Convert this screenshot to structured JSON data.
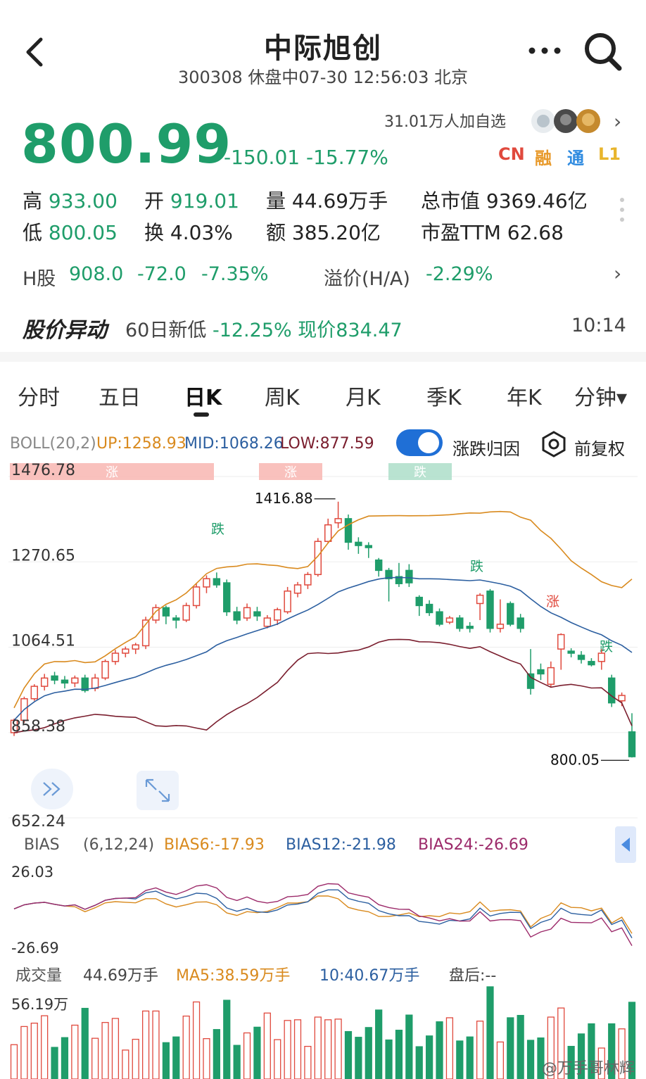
{
  "header": {
    "title": "中际旭创",
    "subtitle": "300308 休盘中07-30 12:56:03 北京"
  },
  "quote": {
    "price": "800.99",
    "change": "-150.01 -15.77%",
    "watch_count": "31.01万人加自选",
    "badges": [
      {
        "label": "CN",
        "color": "#e0493d"
      },
      {
        "label": "融",
        "color": "#e89a2c"
      },
      {
        "label": "通",
        "color": "#2f8be0"
      },
      {
        "label": "L1",
        "color": "#e8b52c"
      }
    ],
    "stats": {
      "high_label": "高",
      "high": "933.00",
      "open_label": "开",
      "open": "919.01",
      "volume_label": "量",
      "volume": "44.69万手",
      "mktcap_label": "总市值",
      "mktcap": "9369.46亿",
      "low_label": "低",
      "low": "800.05",
      "turnover_label": "换",
      "turnover": "4.03%",
      "amount_label": "额",
      "amount": "385.20亿",
      "pe_label": "市盈TTM",
      "pe": "62.68"
    },
    "hshare": {
      "label": "H股",
      "price": "908.0",
      "change": "-72.0",
      "pct": "-7.35%",
      "premium_label": "溢价(H/A)",
      "premium": "-2.29%"
    },
    "alert": {
      "title": "股价异动",
      "label": "60日新低",
      "pct": "-12.25%",
      "current": "现价834.47",
      "time": "10:14"
    }
  },
  "tabs": [
    {
      "label": "分时"
    },
    {
      "label": "五日"
    },
    {
      "label": "日K",
      "active": true
    },
    {
      "label": "周K"
    },
    {
      "label": "月K"
    },
    {
      "label": "季K"
    },
    {
      "label": "年K"
    },
    {
      "label": "分钟▾"
    }
  ],
  "boll": {
    "label": "BOLL(20,2)",
    "up": "UP:1258.93",
    "mid": "MID:1068.26",
    "low": "LOW:877.59",
    "toggle_label": "涨跌归因",
    "fq_label": "前复权"
  },
  "chart_data": {
    "type": "candlestick",
    "ylim": [
      652.24,
      1476.78
    ],
    "yticks": [
      "1476.78",
      "1270.65",
      "1064.51",
      "858.38",
      "652.24"
    ],
    "max_label": "1416.88",
    "min_label": "800.05",
    "events": [
      {
        "label": "涨",
        "color": "#e0493d"
      },
      {
        "label": "涨",
        "color": "#e0493d"
      },
      {
        "label": "跌",
        "color": "#1f9d6a"
      },
      {
        "label": "跌",
        "color": "#1f9d6a"
      },
      {
        "label": "跌",
        "color": "#1f9d6a"
      },
      {
        "label": "涨",
        "color": "#e0493d"
      },
      {
        "label": "跌",
        "color": "#1f9d6a"
      }
    ],
    "candles": [
      [
        858,
        888,
        850,
        892
      ],
      [
        888,
        940,
        882,
        945
      ],
      [
        940,
        970,
        935,
        975
      ],
      [
        970,
        990,
        960,
        1000
      ],
      [
        995,
        985,
        975,
        1005
      ],
      [
        985,
        978,
        965,
        995
      ],
      [
        978,
        990,
        968,
        996
      ],
      [
        990,
        960,
        955,
        998
      ],
      [
        965,
        990,
        958,
        1000
      ],
      [
        990,
        1030,
        985,
        1035
      ],
      [
        1030,
        1050,
        1022,
        1058
      ],
      [
        1050,
        1060,
        1040,
        1066
      ],
      [
        1060,
        1070,
        1048,
        1075
      ],
      [
        1068,
        1130,
        1060,
        1138
      ],
      [
        1130,
        1160,
        1122,
        1168
      ],
      [
        1160,
        1140,
        1120,
        1165
      ],
      [
        1135,
        1130,
        1110,
        1142
      ],
      [
        1130,
        1165,
        1125,
        1172
      ],
      [
        1165,
        1210,
        1158,
        1218
      ],
      [
        1210,
        1230,
        1195,
        1238
      ],
      [
        1230,
        1215,
        1208,
        1245
      ],
      [
        1220,
        1150,
        1140,
        1228
      ],
      [
        1150,
        1130,
        1120,
        1162
      ],
      [
        1135,
        1160,
        1128,
        1170
      ],
      [
        1150,
        1140,
        1128,
        1162
      ],
      [
        1115,
        1135,
        1110,
        1142
      ],
      [
        1130,
        1155,
        1118,
        1160
      ],
      [
        1150,
        1200,
        1145,
        1210
      ],
      [
        1195,
        1215,
        1185,
        1222
      ],
      [
        1215,
        1240,
        1205,
        1246
      ],
      [
        1240,
        1320,
        1235,
        1328
      ],
      [
        1320,
        1360,
        1315,
        1375
      ],
      [
        1365,
        1375,
        1352,
        1416
      ],
      [
        1375,
        1318,
        1300,
        1385
      ],
      [
        1318,
        1310,
        1290,
        1330
      ],
      [
        1310,
        1305,
        1280,
        1318
      ],
      [
        1275,
        1250,
        1235,
        1280
      ],
      [
        1250,
        1230,
        1175,
        1256
      ],
      [
        1235,
        1218,
        1210,
        1268
      ],
      [
        1250,
        1220,
        1210,
        1265
      ],
      [
        1185,
        1165,
        1140,
        1190
      ],
      [
        1168,
        1148,
        1140,
        1178
      ],
      [
        1150,
        1120,
        1115,
        1158
      ],
      [
        1125,
        1135,
        1120,
        1140
      ],
      [
        1135,
        1110,
        1102,
        1142
      ],
      [
        1115,
        1110,
        1100,
        1125
      ],
      [
        1170,
        1190,
        1130,
        1195
      ],
      [
        1200,
        1110,
        1100,
        1205
      ],
      [
        1110,
        1120,
        1100,
        1180
      ],
      [
        1170,
        1120,
        1115,
        1175
      ],
      [
        1135,
        1110,
        1100,
        1145
      ],
      [
        1000,
        965,
        950,
        1060
      ],
      [
        1010,
        1000,
        985,
        1025
      ],
      [
        975,
        1015,
        968,
        1030
      ],
      [
        1060,
        1095,
        1010,
        1098
      ],
      [
        1055,
        1050,
        1040,
        1062
      ],
      [
        1045,
        1035,
        1025,
        1055
      ],
      [
        1030,
        1022,
        1018,
        1038
      ],
      [
        1030,
        1050,
        1010,
        1060
      ],
      [
        990,
        930,
        920,
        998
      ],
      [
        935,
        948,
        922,
        955
      ],
      [
        860,
        800,
        798,
        905
      ]
    ]
  },
  "bias": {
    "label": "BIAS",
    "params": "(6,12,24)",
    "b6": "BIAS6:-17.93",
    "b12": "BIAS12:-21.98",
    "b24": "BIAS24:-26.69",
    "ymax": "26.03",
    "ymin": "-26.69"
  },
  "volume": {
    "label": "成交量",
    "value": "44.69万手",
    "ma5": "MA5:38.59万手",
    "ma10": "10:40.67万手",
    "after": "盘后:--",
    "ymax": "56.19万"
  },
  "watermark": "@万手哥林辉",
  "colors": {
    "up": "#e0493d",
    "down": "#1f9d6a",
    "mid": "#2c5fa0",
    "upper": "#d98a1e",
    "lower": "#7a1e2e"
  }
}
